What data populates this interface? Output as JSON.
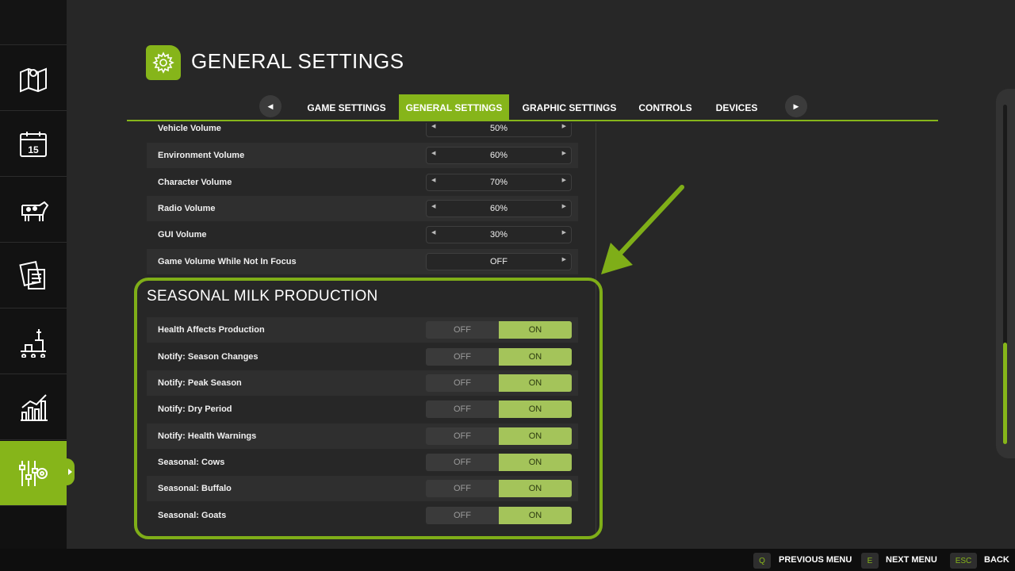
{
  "page_title": "GENERAL SETTINGS",
  "tabs": [
    {
      "label": "GAME SETTINGS"
    },
    {
      "label": "GENERAL SETTINGS"
    },
    {
      "label": "GRAPHIC SETTINGS"
    },
    {
      "label": "CONTROLS"
    },
    {
      "label": "DEVICES"
    }
  ],
  "active_tab": "GENERAL SETTINGS",
  "audio_rows": [
    {
      "label": "Vehicle Volume",
      "value": "50%"
    },
    {
      "label": "Environment Volume",
      "value": "60%"
    },
    {
      "label": "Character Volume",
      "value": "70%"
    },
    {
      "label": "Radio Volume",
      "value": "60%"
    },
    {
      "label": "GUI Volume",
      "value": "30%"
    },
    {
      "label": "Game Volume While Not In Focus",
      "value": "OFF"
    }
  ],
  "section": {
    "title": "SEASONAL MILK PRODUCTION",
    "off_label": "OFF",
    "on_label": "ON",
    "rows": [
      {
        "label": "Health Affects Production",
        "value": "ON"
      },
      {
        "label": "Notify: Season Changes",
        "value": "ON"
      },
      {
        "label": "Notify: Peak Season",
        "value": "ON"
      },
      {
        "label": "Notify: Dry Period",
        "value": "ON"
      },
      {
        "label": "Notify: Health Warnings",
        "value": "ON"
      },
      {
        "label": "Seasonal: Cows",
        "value": "ON"
      },
      {
        "label": "Seasonal: Buffalo",
        "value": "ON"
      },
      {
        "label": "Seasonal: Goats",
        "value": "ON"
      }
    ]
  },
  "sidebar": {
    "items": [
      {
        "icon": "map-icon"
      },
      {
        "icon": "calendar-icon",
        "day": "15"
      },
      {
        "icon": "cow-icon"
      },
      {
        "icon": "contracts-icon"
      },
      {
        "icon": "production-icon"
      },
      {
        "icon": "statistics-icon"
      },
      {
        "icon": "settings-sliders-icon",
        "active": true
      }
    ]
  },
  "footer": {
    "prev": {
      "key": "Q",
      "label": "PREVIOUS MENU"
    },
    "next": {
      "key": "E",
      "label": "NEXT MENU"
    },
    "back": {
      "key": "ESC",
      "label": "BACK"
    }
  },
  "colors": {
    "accent": "#86b51a",
    "toggle_on": "#a4c45a"
  }
}
